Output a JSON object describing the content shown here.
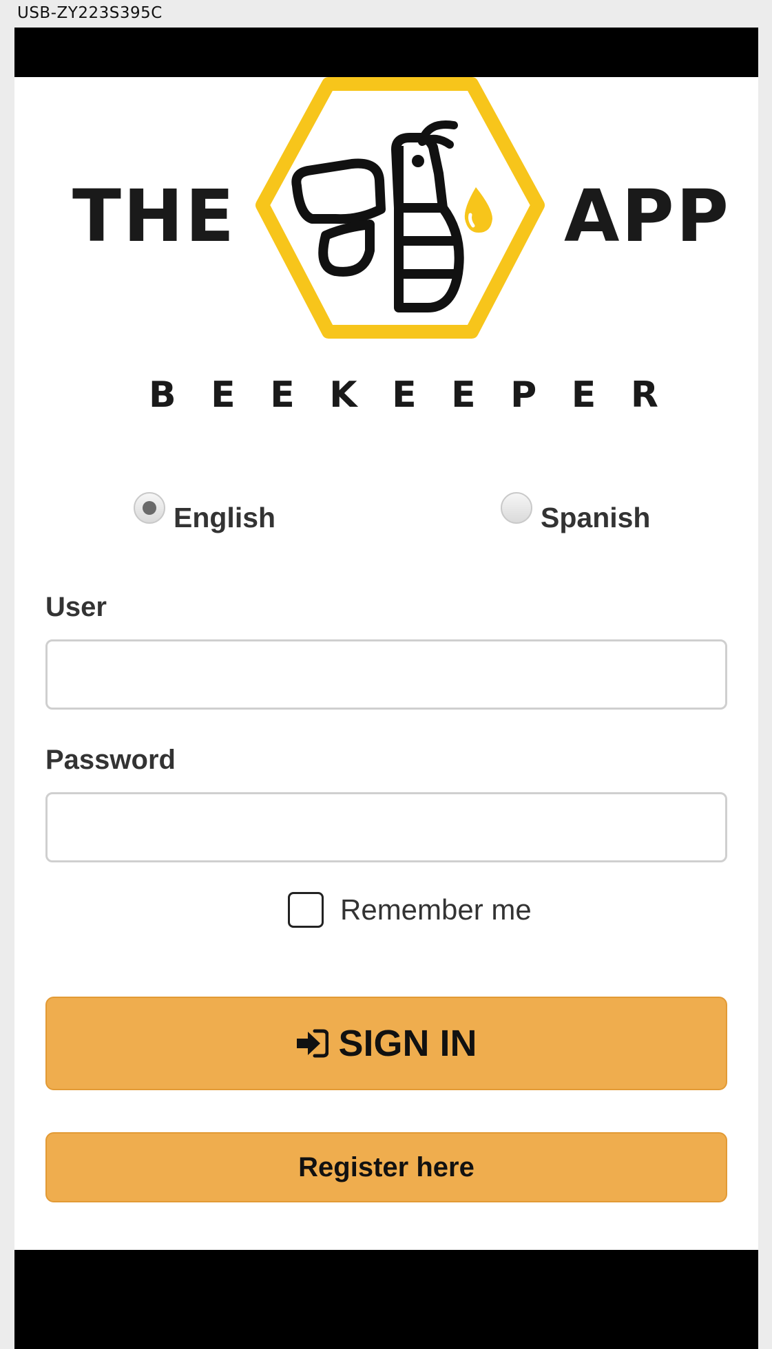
{
  "window": {
    "title": "USB-ZY223S395C"
  },
  "logo": {
    "left_word": "THE",
    "right_word": "APP",
    "subtitle_letters": [
      "B",
      "E",
      "E",
      "K",
      "E",
      "E",
      "P",
      "E",
      "R"
    ],
    "colors": {
      "hexagon": "#f7c51b",
      "text": "#1a1a1a"
    }
  },
  "language": {
    "options": [
      {
        "label": "English",
        "selected": true
      },
      {
        "label": "Spanish",
        "selected": false
      }
    ]
  },
  "form": {
    "user_label": "User",
    "user_value": "",
    "password_label": "Password",
    "password_value": "",
    "remember_label": "Remember me",
    "remember_checked": false
  },
  "buttons": {
    "signin_label": "SIGN IN",
    "signin_icon": "sign-in-icon",
    "register_label": "Register here",
    "accent": "#efad4e"
  }
}
